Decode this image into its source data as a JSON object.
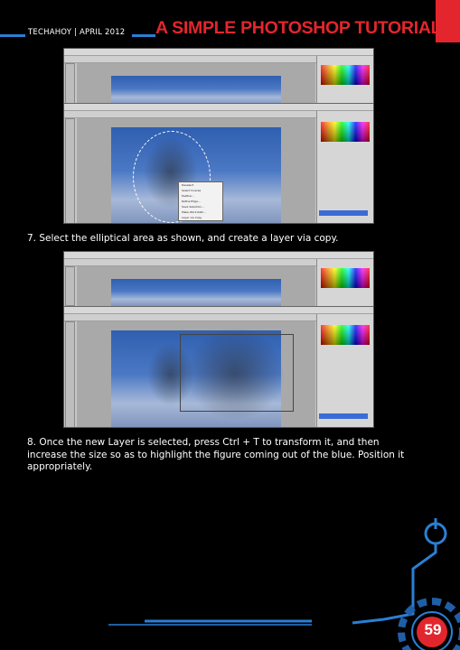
{
  "header": {
    "meta": "TECHAHOY | APRIL 2012",
    "title": "A SIMPLE PHOTOSHOP TUTORIAL"
  },
  "steps": [
    {
      "text": "7. Select the elliptical area as shown, and create a layer via copy."
    },
    {
      "text": "8. Once the new Layer is selected, press Ctrl + T to transform it, and then increase the size so as to highlight the figure coming out of the blue. Position it appropriately."
    }
  ],
  "context_menu": [
    "Deselect",
    "Select Inverse",
    "Feather...",
    "Refine Edge...",
    "Save Selection...",
    "Make Work Path...",
    "Layer via Copy"
  ],
  "page_number": "59",
  "colors": {
    "accent_blue": "#2a7fd4",
    "title_red": "#e3262d",
    "background": "#000000"
  }
}
